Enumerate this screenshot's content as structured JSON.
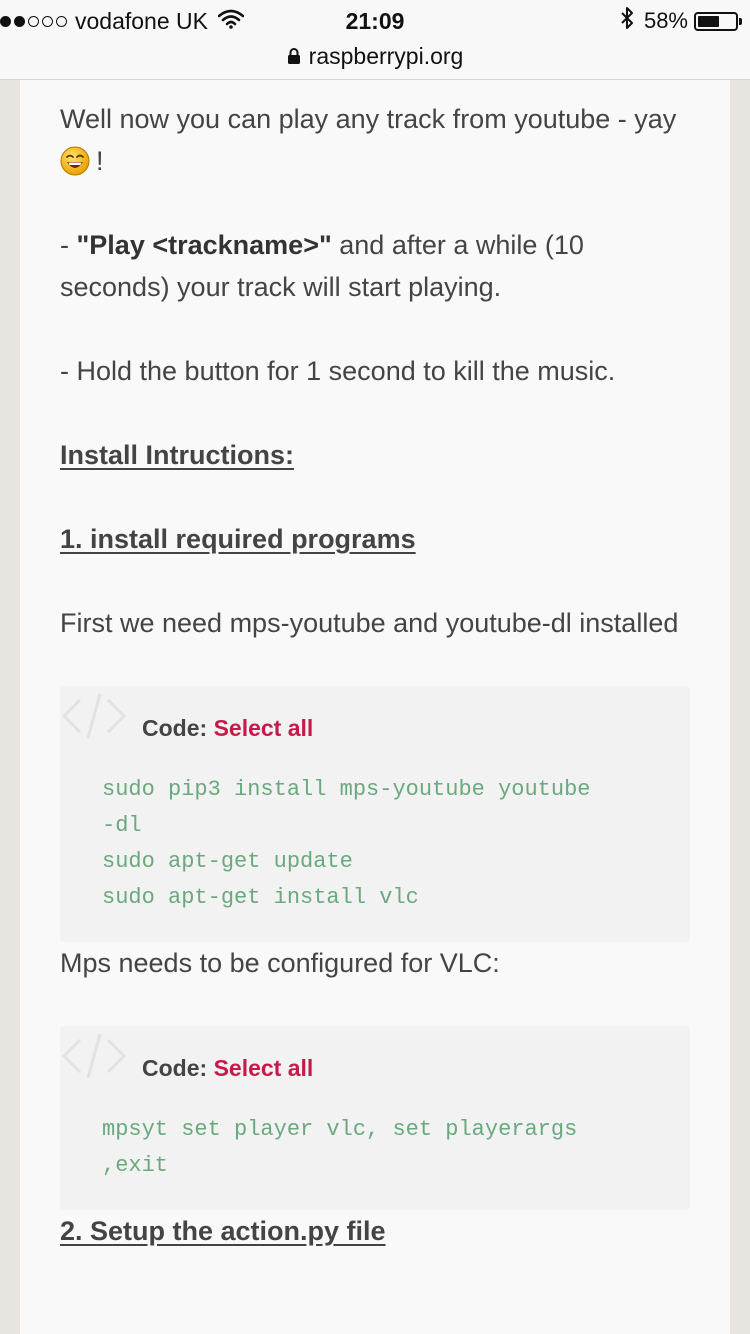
{
  "status_bar": {
    "carrier": "vodafone UK",
    "time": "21:09",
    "battery": "58%",
    "battery_level": 0.58,
    "signal_bars_on": 2,
    "signal_bars_total": 5
  },
  "url_bar": {
    "domain": "raspberrypi.org"
  },
  "article": {
    "intro_line1": "Well now you can play any track from youtube - yay",
    "intro_line2": "!",
    "play_prefix": "- ",
    "play_bold": "\"Play <trackname>\"",
    "play_rest": " and after a while (10 seconds) your track will start playing.",
    "hold_text": "- Hold the button for 1 second to kill the music.",
    "install_heading": "Install Intructions:",
    "step1_heading": "1. install required programs",
    "step1_text": "First we need mps-youtube and youtube-dl installed",
    "code1": {
      "label": "Code:",
      "select_all": "Select all",
      "lines": "sudo pip3 install mps-youtube youtube\n-dl\nsudo apt-get update\nsudo apt-get install vlc"
    },
    "mps_text": "Mps needs to be configured for VLC:",
    "code2": {
      "label": "Code:",
      "select_all": "Select all",
      "lines": "mpsyt set player vlc, set playerargs\n,exit"
    },
    "step2_heading": "2. Setup the action.py file"
  }
}
